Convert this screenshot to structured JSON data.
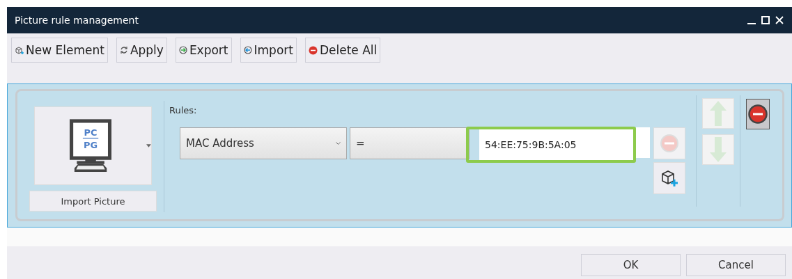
{
  "window": {
    "title": "Picture rule management"
  },
  "toolbar": [
    {
      "label": "New Element",
      "kind": "new"
    },
    {
      "label": "Apply",
      "kind": "apply"
    },
    {
      "label": "Export",
      "kind": "export"
    },
    {
      "label": "Import",
      "kind": "import"
    },
    {
      "label": "Delete All",
      "kind": "delete"
    }
  ],
  "element": {
    "preview": {
      "top": "PC",
      "bottom": "PG"
    },
    "import_button": "Import Picture",
    "rules_label": "Rules:",
    "rule": {
      "field": "MAC Address",
      "operator": "=",
      "value": "54:EE:75:9B:5A:05",
      "focused": true,
      "remove_disabled": true
    },
    "move_up_disabled": true,
    "move_down_disabled": true
  },
  "buttons": [
    "OK",
    "Cancel"
  ]
}
